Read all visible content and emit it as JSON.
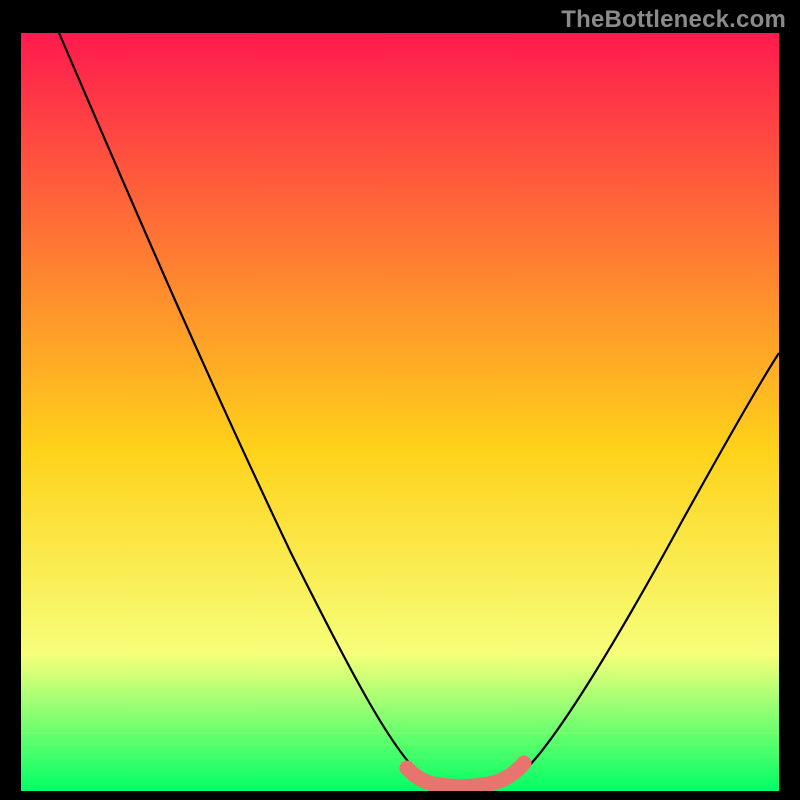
{
  "watermark": "TheBottleneck.com",
  "colors": {
    "bg": "#000000",
    "grad_top": "#ff1a4e",
    "grad_mid": "#ffd21a",
    "grad_low": "#f6ff7a",
    "grad_bottom": "#00ff66",
    "curve": "#000000",
    "rose": "#e8746e",
    "watermark": "#8a8a8a"
  },
  "chart_data": {
    "type": "line",
    "title": "",
    "xlabel": "",
    "ylabel": "",
    "xlim": [
      0,
      100
    ],
    "ylim": [
      0,
      100
    ],
    "series": [
      {
        "name": "bottleneck-curve",
        "x": [
          5,
          8,
          12,
          16,
          20,
          25,
          30,
          35,
          40,
          45,
          50,
          52,
          55,
          58,
          60,
          62,
          66,
          70,
          75,
          80,
          85,
          90,
          95,
          100
        ],
        "values": [
          100,
          90,
          80,
          71,
          63,
          54,
          46,
          38,
          31,
          23,
          14,
          10,
          5,
          2,
          1,
          1,
          4,
          9,
          16,
          24,
          32,
          40,
          47,
          53
        ]
      },
      {
        "name": "optimal-zone-highlight",
        "x": [
          51,
          66
        ],
        "values": [
          2,
          2
        ]
      }
    ]
  }
}
